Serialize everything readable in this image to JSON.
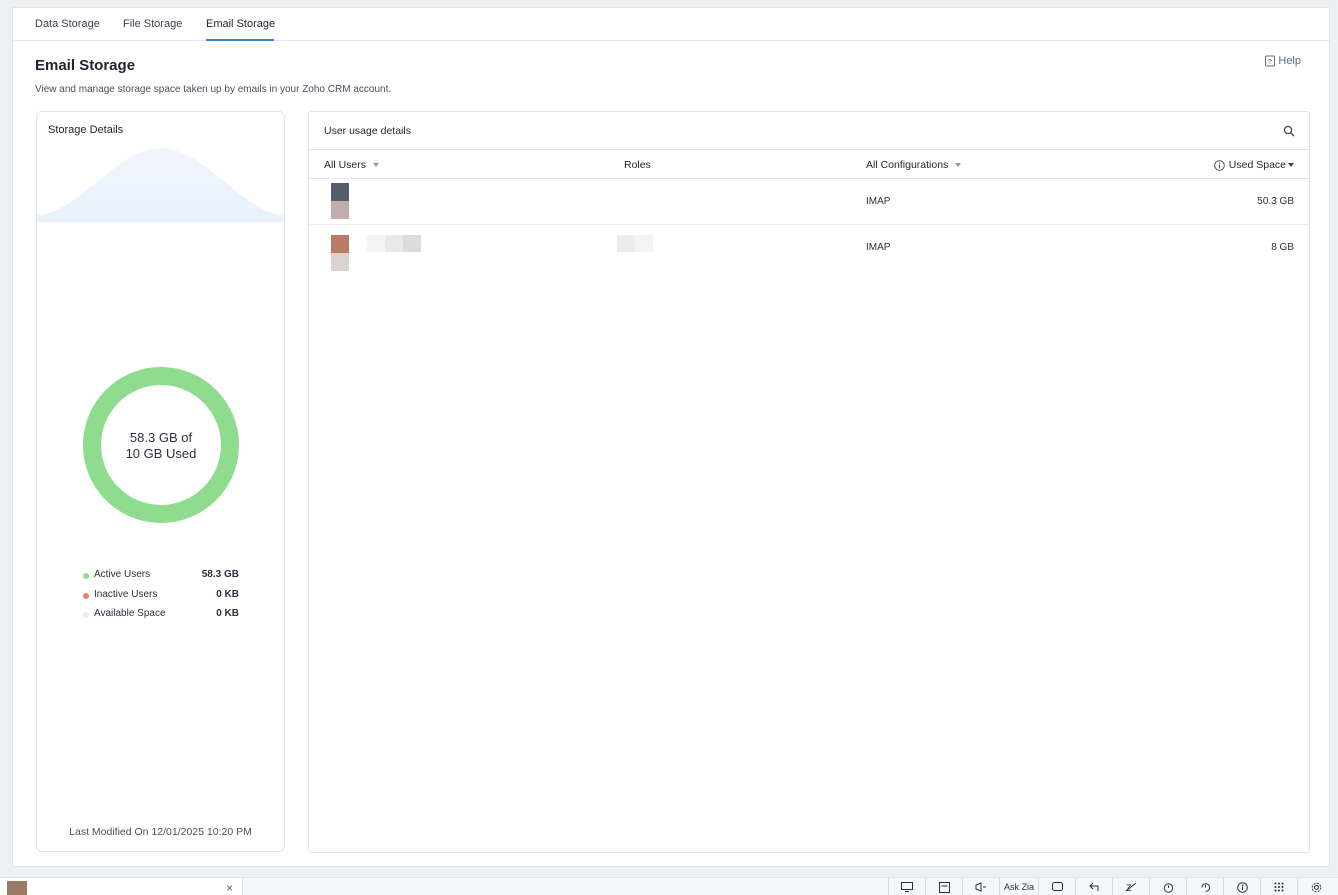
{
  "tabs": [
    {
      "label": "Data Storage"
    },
    {
      "label": "File Storage"
    },
    {
      "label": "Email Storage"
    }
  ],
  "page": {
    "title": "Email Storage",
    "description": "View and manage storage space taken up by emails in your Zoho CRM account.",
    "help_label": "Help"
  },
  "storage": {
    "title": "Storage Details",
    "usage_line1": "58.3 GB of",
    "usage_line2": "10 GB Used",
    "used_fraction": 1.0,
    "legend": [
      {
        "label": "Active Users",
        "value": "58.3 GB",
        "color": "#8fdc8f"
      },
      {
        "label": "Inactive Users",
        "value": "0 KB",
        "color": "#f07a7a"
      },
      {
        "label": "Available Space",
        "value": "0 KB",
        "color": "#e9edf3"
      }
    ],
    "last_modified": "Last Modified On 12/01/2025 10:20 PM"
  },
  "usage": {
    "title": "User usage details",
    "columns": {
      "users": "All Users",
      "roles": "Roles",
      "configurations": "All Configurations",
      "used_space": "Used Space"
    },
    "rows": [
      {
        "configuration": "IMAP",
        "used_space": "50.3 GB"
      },
      {
        "configuration": "IMAP",
        "used_space": "8 GB"
      }
    ]
  },
  "taskbar": {
    "close_label": "×",
    "items": [
      "screen-share-icon",
      "notes-icon",
      "announce-icon",
      "Ask Zia",
      "feedback-icon",
      "reply-icon",
      "zia-off-icon",
      "alarm-icon",
      "history-icon",
      "accessibility-icon",
      "apps-grid-icon",
      "settings-icon"
    ],
    "ask_zia_label": "Ask Zia"
  }
}
